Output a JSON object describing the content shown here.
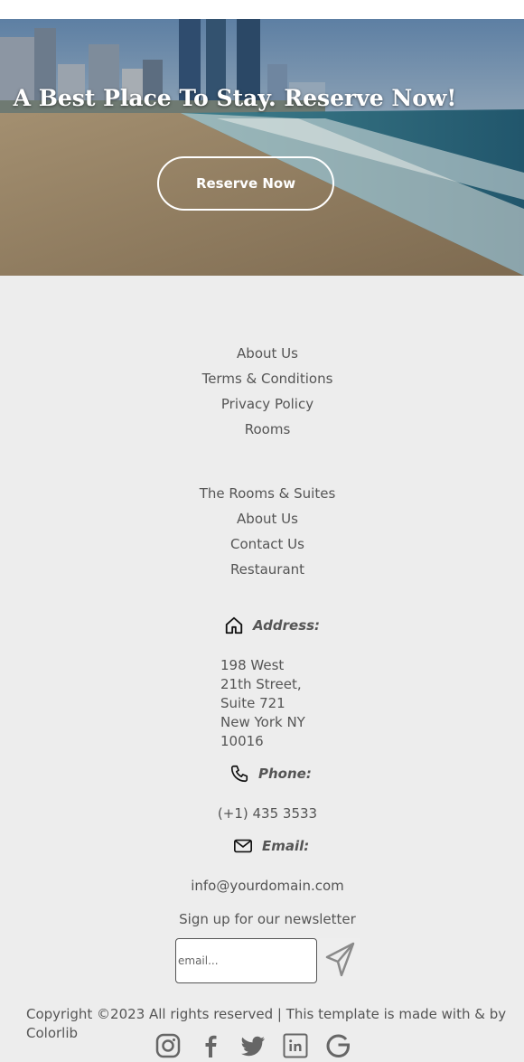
{
  "hero": {
    "title": "A Best Place To Stay. Reserve Now!",
    "button_label": "Reserve Now"
  },
  "footer": {
    "links_primary": [
      "About Us",
      "Terms & Conditions",
      "Privacy Policy",
      "Rooms"
    ],
    "links_secondary": [
      "The Rooms & Suites",
      "About Us",
      "Contact Us",
      "Restaurant"
    ],
    "address": {
      "label": "Address:",
      "icon": "home-icon",
      "lines": [
        "198 West",
        "21th Street,",
        "Suite 721",
        "New York NY",
        "10016"
      ]
    },
    "phone": {
      "label": "Phone:",
      "icon": "phone-icon",
      "value": "(+1) 435 3533"
    },
    "email": {
      "label": "Email:",
      "icon": "envelope-icon",
      "value": "info@yourdomain.com"
    },
    "newsletter": {
      "label": "Sign up for our newsletter",
      "placeholder": "email...",
      "send_icon": "send-icon"
    },
    "copyright": {
      "part1": "Copyright ©2023 All rights reserved | This template is made with",
      "part2": "& by Colorlib"
    },
    "social": [
      "instagram-icon",
      "facebook-icon",
      "twitter-icon",
      "linkedin-icon",
      "google-icon"
    ]
  },
  "colors": {
    "footer_bg": "#ededed",
    "text": "#555555",
    "hero_text": "#ffffff"
  }
}
